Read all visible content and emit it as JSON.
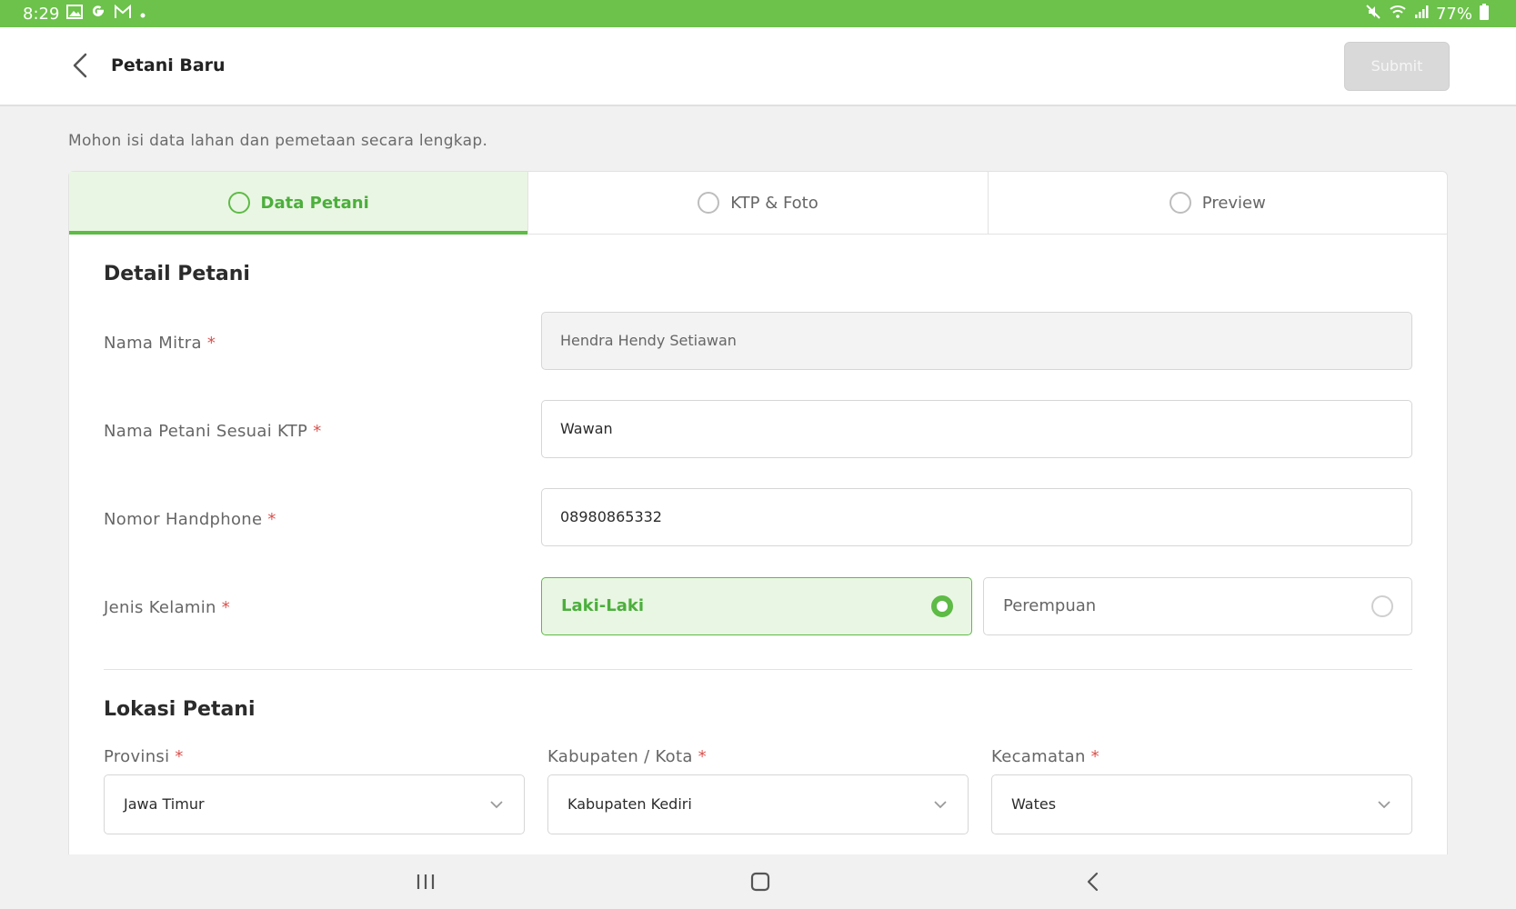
{
  "status_bar": {
    "time": "8:29",
    "left_icons": [
      "gallery-icon",
      "google-icon",
      "gmail-icon",
      "dot-icon"
    ],
    "right_icons": [
      "mute-icon",
      "wifi-icon",
      "signal-icon"
    ],
    "battery": "77%"
  },
  "app_bar": {
    "title": "Petani Baru",
    "submit_label": "Submit"
  },
  "hint": "Mohon isi data lahan dan pemetaan secara lengkap.",
  "tabs": [
    {
      "label": "Data Petani",
      "active": true
    },
    {
      "label": "KTP & Foto",
      "active": false
    },
    {
      "label": "Preview",
      "active": false
    }
  ],
  "detail": {
    "title": "Detail Petani",
    "nama_mitra": {
      "label": "Nama Mitra",
      "value": "Hendra Hendy Setiawan"
    },
    "nama_petani": {
      "label": "Nama Petani Sesuai KTP",
      "value": "Wawan"
    },
    "nomor_hp": {
      "label": "Nomor Handphone",
      "value": "08980865332"
    },
    "jenis_kelamin": {
      "label": "Jenis Kelamin",
      "options": [
        "Laki-Laki",
        "Perempuan"
      ],
      "selected": "Laki-Laki"
    },
    "required_mark": "*"
  },
  "lokasi": {
    "title": "Lokasi Petani",
    "provinsi": {
      "label": "Provinsi",
      "value": "Jawa Timur"
    },
    "kabupaten": {
      "label": "Kabupaten / Kota",
      "value": "Kabupaten Kediri"
    },
    "kecamatan": {
      "label": "Kecamatan",
      "value": "Wates"
    }
  },
  "colors": {
    "status_bar": "#6cc24a",
    "accent": "#5dbb46",
    "accent_bg": "#eaf6e4",
    "required": "#d9534f"
  }
}
